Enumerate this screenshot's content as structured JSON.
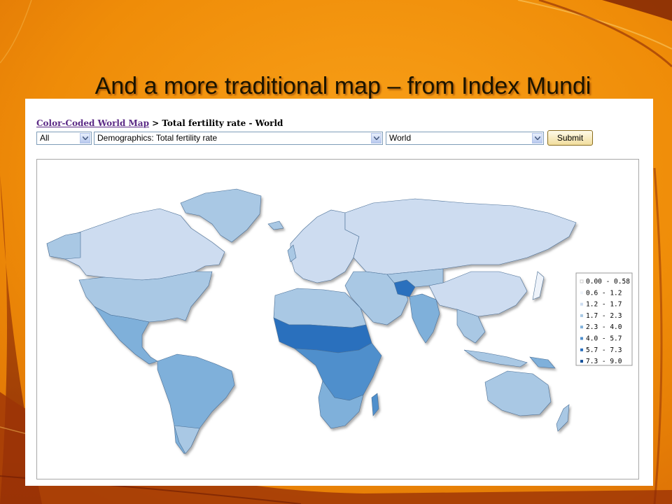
{
  "slide": {
    "title": "And a more traditional map – from Index Mundi"
  },
  "breadcrumb": {
    "link": "Color-Coded World Map",
    "rest": " > Total fertility rate - World"
  },
  "filters": {
    "region_value": "All",
    "indicator_value": "Demographics: Total fertility rate",
    "scope_value": "World",
    "submit_label": "Submit"
  },
  "legend": {
    "bins": [
      {
        "label": "0.00 - 0.58",
        "color": "#ffffff"
      },
      {
        "label": "0.6 - 1.2",
        "color": "#eef3fa"
      },
      {
        "label": "1.2 - 1.7",
        "color": "#cddcf0"
      },
      {
        "label": "1.7 - 2.3",
        "color": "#a9c8e4"
      },
      {
        "label": "2.3 - 4.0",
        "color": "#7fb0da"
      },
      {
        "label": "4.0 - 5.7",
        "color": "#4f8fcc"
      },
      {
        "label": "5.7 - 7.3",
        "color": "#2a6fbd"
      },
      {
        "label": "7.3 - 9.0",
        "color": "#14509a"
      }
    ]
  },
  "colors": {
    "slide_orange": "#f28c0a",
    "slide_dark": "#8a2806",
    "link_purple": "#5b2a86"
  },
  "icons": [
    "dropdown-arrow-icon"
  ]
}
